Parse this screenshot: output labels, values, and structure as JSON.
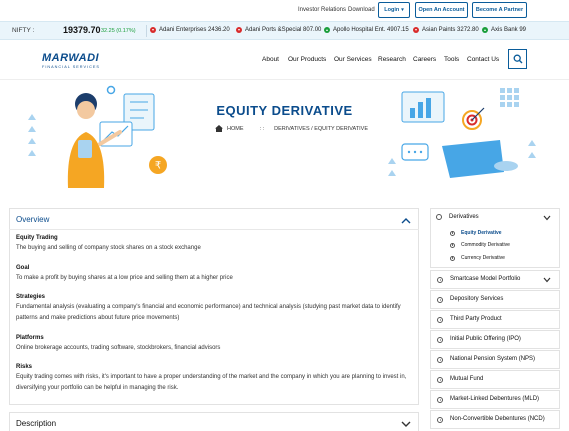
{
  "topbar": {
    "investor_relations": "Investor Relations",
    "download": "Download",
    "login": "Login",
    "open_account": "Open An Account",
    "become_partner": "Become A Partner"
  },
  "ticker": {
    "nifty_label": "NIFTY :",
    "nifty_value": "19379.70",
    "nifty_change": "32.25 (0.17%)",
    "items": [
      {
        "text": "Adani Enterprises 2436.20",
        "dir": "down"
      },
      {
        "text": "Adani Ports &Special 807.00",
        "dir": "down"
      },
      {
        "text": "Apollo Hospital Ent. 4907.15",
        "dir": "up"
      },
      {
        "text": "Asian Paints 3272.80",
        "dir": "down"
      },
      {
        "text": "Axis Bank 99",
        "dir": "up"
      }
    ]
  },
  "logo": {
    "name": "MARWADI",
    "tagline": "FINANCIAL SERVICES"
  },
  "nav": [
    "About",
    "Our Products",
    "Our Services",
    "Research",
    "Careers",
    "Tools",
    "Contact Us"
  ],
  "hero": {
    "title": "EQUITY DERIVATIVE",
    "crumb_home": "HOME",
    "crumb_sep": ": :",
    "crumb_path": "DERIVATIVES / EQUITY DERIVATIVE"
  },
  "overview": {
    "heading": "Overview",
    "sections": [
      {
        "title": "Equity Trading",
        "text": "The buying and selling of company stock shares on a stock exchange"
      },
      {
        "title": "Goal",
        "text": "To make a profit by buying shares at a low price and selling them at a higher price"
      },
      {
        "title": "Strategies",
        "text": "Fundamental analysis (evaluating a company's financial and economic performance) and technical analysis (studying past market data to identify patterns and make predictions about future price movements)"
      },
      {
        "title": "Platforms",
        "text": "Online brokerage accounts, trading software, stockbrokers, financial advisors"
      },
      {
        "title": "Risks",
        "text": "Equity trading comes with risks, it's important to have a proper understanding of the market and the company in which you are planning to invest in, diversifying your portfolio can be helpful in managing the risk."
      }
    ]
  },
  "description": {
    "heading": "Description"
  },
  "sidebar": {
    "derivatives": "Derivatives",
    "sub_items": [
      {
        "label": "Equity Derivative",
        "active": true
      },
      {
        "label": "Commodity Derivative",
        "active": false
      },
      {
        "label": "Currency Derivative",
        "active": false
      }
    ],
    "smartcase": "Smartcase Model Portfolio",
    "items": [
      "Depository Services",
      "Third Party Product",
      "Initial Public Offering (IPO)",
      "National Pension System (NPS)",
      "Mutual Fund",
      "Market-Linked Debentures (MLD)",
      "Non-Convertible Debentures (NCD)"
    ]
  },
  "colors": {
    "brand": "#0b4c8c",
    "accent_link": "#0a5c9a",
    "up": "#1a9e3b",
    "down": "#d92b2b",
    "ticker_bg": "#eaf5fb",
    "illustration_blue": "#47a6e6",
    "illustration_orange": "#f5a623"
  },
  "icons": [
    "home-icon",
    "search-icon",
    "chevron-up-icon",
    "chevron-down-icon",
    "arrow-circle-icon",
    "rupee-icon"
  ]
}
